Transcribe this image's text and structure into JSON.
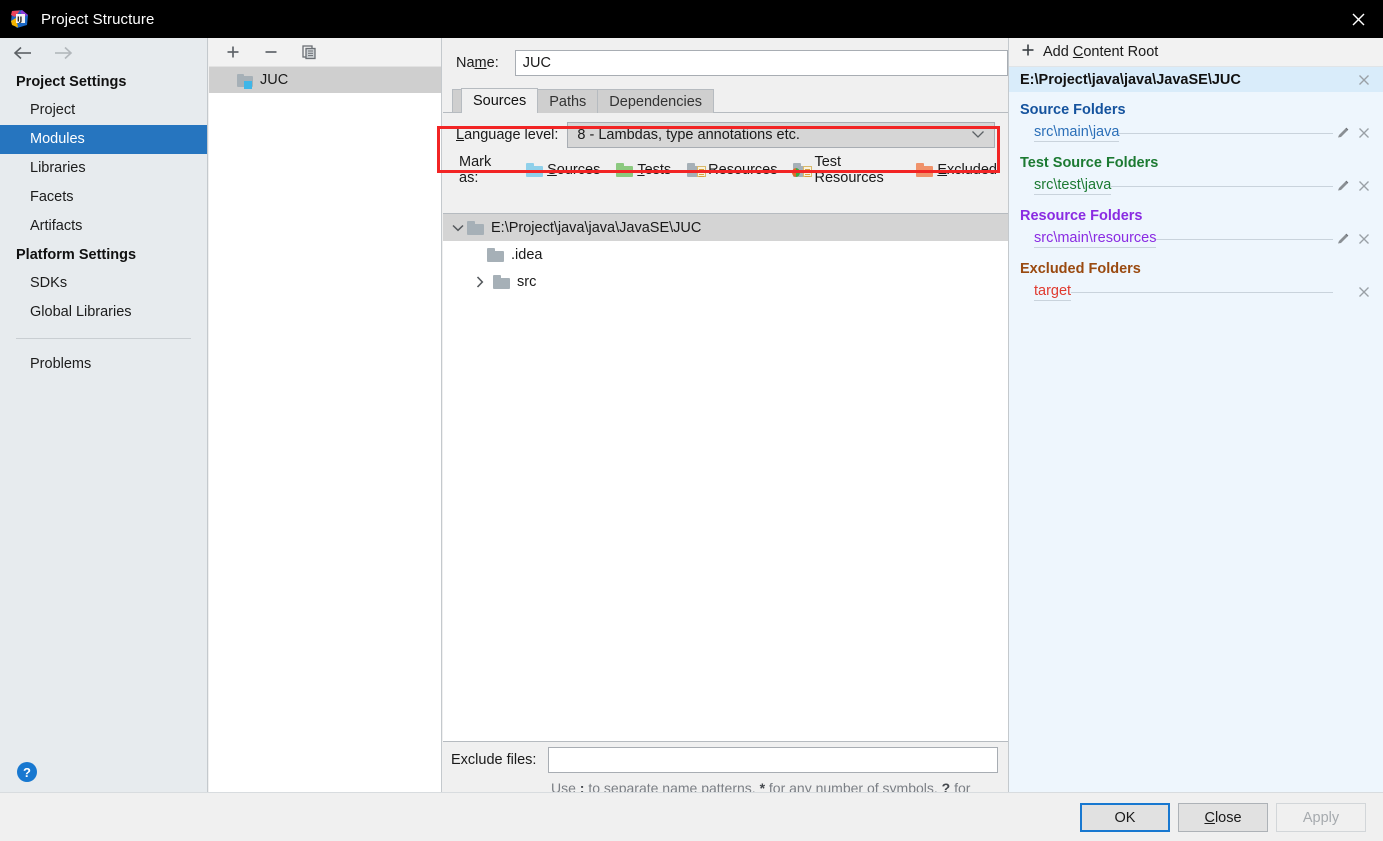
{
  "window": {
    "title": "Project Structure",
    "app_icon": "intellij-idea-logo-icon",
    "close_icon": "close-icon"
  },
  "sidebar": {
    "back_icon": "arrow-left-icon",
    "forward_icon": "arrow-right-icon",
    "groups": [
      {
        "title": "Project Settings",
        "items": [
          {
            "label": "Project",
            "selected": false
          },
          {
            "label": "Modules",
            "selected": true
          },
          {
            "label": "Libraries",
            "selected": false
          },
          {
            "label": "Facets",
            "selected": false
          },
          {
            "label": "Artifacts",
            "selected": false
          }
        ]
      },
      {
        "title": "Platform Settings",
        "items": [
          {
            "label": "SDKs",
            "selected": false
          },
          {
            "label": "Global Libraries",
            "selected": false
          }
        ]
      }
    ],
    "extra_items": [
      {
        "label": "Problems",
        "selected": false
      }
    ],
    "help_label": "?",
    "selected_accent": "#2675bf"
  },
  "modules_panel": {
    "toolbar": {
      "add_icon": "plus-icon",
      "remove_icon": "minus-icon",
      "copy_icon": "copy-icon"
    },
    "modules": [
      {
        "name": "JUC",
        "icon": "module-folder-icon",
        "selected": true
      }
    ]
  },
  "module_editor": {
    "name_label": "Name:",
    "name_label_mnemonic": "m",
    "name_value": "JUC",
    "name_placeholder": "",
    "tabs": [
      {
        "label": "Sources",
        "active": true
      },
      {
        "label": "Paths",
        "active": false
      },
      {
        "label": "Dependencies",
        "active": false
      }
    ],
    "language_level": {
      "label": "Language level:",
      "label_mnemonic": "L",
      "value": "8 - Lambdas, type annotations etc.",
      "dropdown_icon": "chevron-down-icon",
      "highlight_color": "#f22424"
    },
    "mark_as": {
      "label": "Mark as:",
      "options": [
        {
          "label": "Sources",
          "mnemonic": "S",
          "icon": "sources-folder-icon",
          "color": "#8fd0ea"
        },
        {
          "label": "Tests",
          "mnemonic": "T",
          "icon": "tests-folder-icon",
          "color": "#8cc97f"
        },
        {
          "label": "Resources",
          "mnemonic": "",
          "icon": "resources-folder-icon",
          "color": "#a6b0b7"
        },
        {
          "label": "Test Resources",
          "mnemonic": "",
          "icon": "test-resources-folder-icon",
          "color": "#a6b0b7"
        },
        {
          "label": "Excluded",
          "mnemonic": "E",
          "icon": "excluded-folder-icon",
          "color": "#f0926a"
        }
      ]
    },
    "tree": [
      {
        "label": "E:\\Project\\java\\java\\JavaSE\\JUC",
        "depth": 0,
        "twisty": "expanded",
        "selected": true,
        "icon": "folder-icon"
      },
      {
        "label": ".idea",
        "depth": 1,
        "twisty": "none",
        "selected": false,
        "icon": "folder-icon"
      },
      {
        "label": "src",
        "depth": 1,
        "twisty": "collapsed",
        "selected": false,
        "icon": "folder-icon"
      }
    ],
    "exclude_files": {
      "label": "Exclude files:",
      "value": "",
      "placeholder": "",
      "hint_part1": "Use ",
      "hint_semicolon": ";",
      "hint_part2": " to separate name patterns, ",
      "hint_star": "*",
      "hint_part3": " for any number of symbols, ",
      "hint_question": "?",
      "hint_part4": " for one."
    }
  },
  "content_roots_panel": {
    "add_content_root": "Add Content Root",
    "add_content_root_mnemonic": "C",
    "add_icon": "plus-icon",
    "root": {
      "path": "E:\\Project\\java\\java\\JavaSE\\JUC",
      "remove_icon": "close-icon"
    },
    "groups": [
      {
        "title": "Source Folders",
        "color": "#15539e",
        "style": "blue",
        "folders": [
          {
            "path": "src\\main\\java",
            "edit_icon": "pencil-icon",
            "remove_icon": "close-icon",
            "has_edit": true,
            "style": "blue"
          }
        ]
      },
      {
        "title": "Test Source Folders",
        "color": "#1c7a32",
        "style": "green",
        "folders": [
          {
            "path": "src\\test\\java",
            "edit_icon": "pencil-icon",
            "remove_icon": "close-icon",
            "has_edit": true,
            "style": "green"
          }
        ]
      },
      {
        "title": "Resource Folders",
        "color": "#8a2be2",
        "style": "purple",
        "folders": [
          {
            "path": "src\\main\\resources",
            "edit_icon": "pencil-icon",
            "remove_icon": "close-icon",
            "has_edit": true,
            "style": "purple"
          }
        ]
      },
      {
        "title": "Excluded Folders",
        "color": "#9a4a10",
        "style": "brown",
        "folders": [
          {
            "path": "target",
            "edit_icon": "",
            "remove_icon": "close-icon",
            "has_edit": false,
            "style": "red"
          }
        ]
      }
    ]
  },
  "footer": {
    "buttons": [
      {
        "label": "OK",
        "mnemonic": "",
        "state": "focused"
      },
      {
        "label": "Close",
        "mnemonic": "C",
        "state": "normal"
      },
      {
        "label": "Apply",
        "mnemonic": "",
        "state": "disabled"
      }
    ]
  }
}
